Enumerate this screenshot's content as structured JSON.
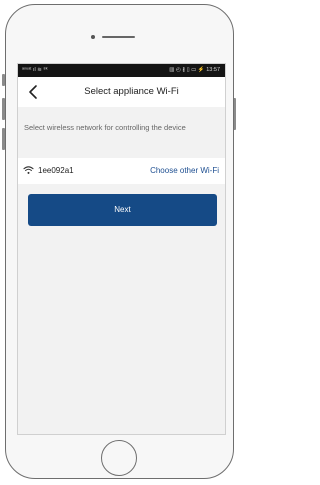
{
  "status_bar": {
    "left_text": "ᵃᵒᵘᵃᵗ",
    "left_icons": "ıl ≋ ⁸ᵏ",
    "right_text": "▥ ◴ ∦ ▯ ▭ ⚡ 13:57"
  },
  "nav": {
    "back_icon": "chevron-left-icon",
    "title": "Select appliance Wi-Fi"
  },
  "main": {
    "hint": "Select wireless network for controlling the device",
    "network": {
      "icon": "wifi-icon",
      "ssid": "1ee092a1",
      "choose_other_label": "Choose other Wi-Fi"
    },
    "next_label": "Next"
  },
  "colors": {
    "accent": "#154a86",
    "link": "#1e4f91",
    "status_bar": "#141414",
    "screen_bg": "#f2f2f2"
  }
}
